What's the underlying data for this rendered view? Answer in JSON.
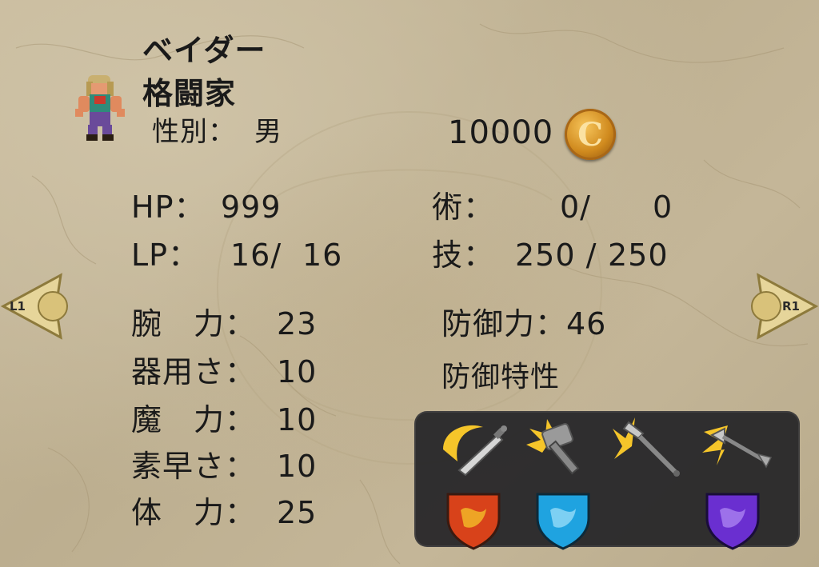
{
  "character": {
    "name": "ベイダー",
    "class": "格闘家",
    "sex_label": "性別：",
    "sex_value": "男"
  },
  "money": {
    "amount": "10000",
    "currency_icon": "C"
  },
  "vitals": {
    "hp_label": "HP：",
    "hp_value": "999",
    "lp_label": "LP：",
    "lp_current": "16/",
    "lp_max": "16",
    "jutsu_label": "術：",
    "jutsu_current": "0/",
    "jutsu_max": "0",
    "waza_label": "技：",
    "waza_current": "250 /",
    "waza_max": "250"
  },
  "stats": [
    {
      "label": "腕　力：",
      "value": "23"
    },
    {
      "label": "器用さ：",
      "value": "10"
    },
    {
      "label": "魔　力：",
      "value": "10"
    },
    {
      "label": "素早さ：",
      "value": "10"
    },
    {
      "label": "体　力：",
      "value": "25"
    }
  ],
  "defense": {
    "label": "防御力：46",
    "attributes_label": "防御特性"
  },
  "defense_icons": {
    "physical": [
      "slash-sword-icon",
      "blunt-hammer-icon",
      "pierce-spear-icon",
      "shoot-arrow-icon"
    ],
    "elemental": [
      "fire-shield-icon",
      "ice-shield-icon",
      "dark-shield-icon"
    ]
  },
  "nav": {
    "left": "L1",
    "right": "R1"
  },
  "colors": {
    "background": "#c2b497",
    "panel": "#232326",
    "coin": "#d08a1e",
    "fire": "#d8421a",
    "ice": "#1fa3e0",
    "dark": "#6a2fd0",
    "gold": "#f5c52a"
  }
}
